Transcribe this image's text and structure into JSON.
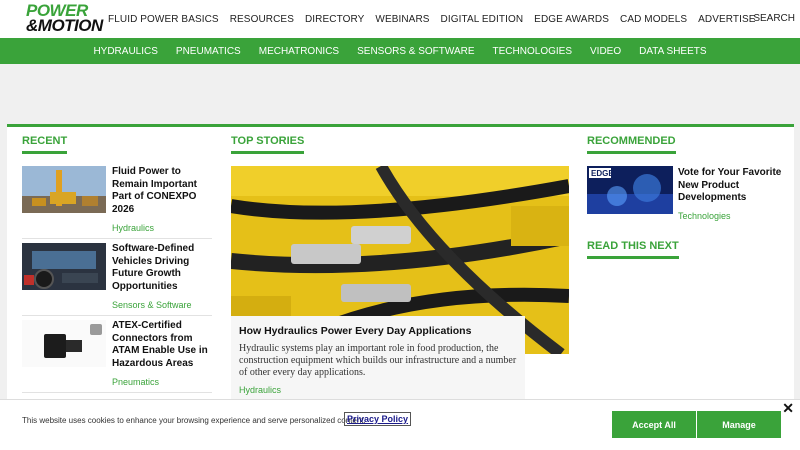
{
  "logo": {
    "line1": "POWER",
    "line2": "&MOTION"
  },
  "top_nav": [
    "FLUID POWER BASICS",
    "RESOURCES",
    "DIRECTORY",
    "WEBINARS",
    "DIGITAL EDITION",
    "EDGE AWARDS",
    "CAD MODELS",
    "ADVERTISE"
  ],
  "search_label": "SEARCH",
  "green_nav": [
    "HYDRAULICS",
    "PNEUMATICS",
    "MECHATRONICS",
    "SENSORS & SOFTWARE",
    "TECHNOLOGIES",
    "VIDEO",
    "DATA SHEETS"
  ],
  "recent": {
    "title": "RECENT",
    "items": [
      {
        "title": "Fluid Power to Remain Important Part of CONEXPO 2026",
        "tag": "Hydraulics"
      },
      {
        "title": "Software-Defined Vehicles Driving Future Growth Opportunities",
        "tag": "Sensors & Software"
      },
      {
        "title": "ATEX-Certified Connectors from ATAM Enable Use in Hazardous Areas",
        "tag": "Pneumatics"
      }
    ]
  },
  "top_stories": {
    "title": "TOP STORIES",
    "hero_title": "How Hydraulics Power Every Day Applications",
    "hero_desc": "Hydraulic systems play an important role in food production, the construction equipment which builds our infrastructure and a number of other every day applications.",
    "hero_tag": "Hydraulics"
  },
  "recommended": {
    "title": "RECOMMENDED",
    "item_title": "Vote for Your Favorite New Product Developments",
    "item_tag": "Technologies",
    "thumb_text": "EDGE"
  },
  "read_next": {
    "title": "READ THIS NEXT"
  },
  "cookie": {
    "text": "This website uses cookies to enhance your browsing experience and serve personalized content.",
    "privacy_label": "Privacy Policy",
    "accept_label": "Accept All",
    "manage_label": "Manage",
    "close_label": "✕"
  }
}
